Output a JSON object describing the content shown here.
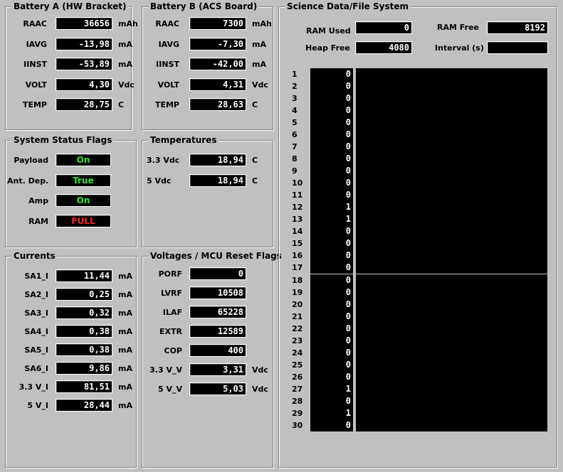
{
  "battery_a": {
    "title": "Battery A (HW Bracket)",
    "rows": [
      {
        "label": "RAAC",
        "value": "36656",
        "unit": "mAh"
      },
      {
        "label": "IAVG",
        "value": "-13,98",
        "unit": "mA"
      },
      {
        "label": "IINST",
        "value": "-53,89",
        "unit": "mA"
      },
      {
        "label": "VOLT",
        "value": "4,30",
        "unit": "Vdc"
      },
      {
        "label": "TEMP",
        "value": "28,75",
        "unit": "C"
      }
    ]
  },
  "battery_b": {
    "title": "Battery B (ACS Board)",
    "rows": [
      {
        "label": "RAAC",
        "value": "7300",
        "unit": "mAh"
      },
      {
        "label": "IAVG",
        "value": "-7,30",
        "unit": "mA"
      },
      {
        "label": "IINST",
        "value": "-42,00",
        "unit": "mA"
      },
      {
        "label": "VOLT",
        "value": "4,31",
        "unit": "Vdc"
      },
      {
        "label": "TEMP",
        "value": "28,63",
        "unit": "C"
      }
    ]
  },
  "status_flags": {
    "title": "System Status Flags",
    "rows": [
      {
        "label": "Payload",
        "value": "On",
        "color": "#2ee82e"
      },
      {
        "label": "Ant. Dep.",
        "value": "True",
        "color": "#2ee82e"
      },
      {
        "label": "Amp",
        "value": "On",
        "color": "#2ee82e"
      },
      {
        "label": "RAM",
        "value": "FULL",
        "color": "#ff2020"
      }
    ]
  },
  "temperatures": {
    "title": "Temperatures",
    "rows": [
      {
        "label": "3.3 Vdc",
        "value": "18,94",
        "unit": "C"
      },
      {
        "label": "5 Vdc",
        "value": "18,94",
        "unit": "C"
      }
    ]
  },
  "currents": {
    "title": "Currents",
    "rows": [
      {
        "label": "SA1_I",
        "value": "11,44",
        "unit": "mA"
      },
      {
        "label": "SA2_I",
        "value": "0,25",
        "unit": "mA"
      },
      {
        "label": "SA3_I",
        "value": "0,32",
        "unit": "mA"
      },
      {
        "label": "SA4_I",
        "value": "0,38",
        "unit": "mA"
      },
      {
        "label": "SA5_I",
        "value": "0,38",
        "unit": "mA"
      },
      {
        "label": "SA6_I",
        "value": "9,86",
        "unit": "mA"
      },
      {
        "label": "3.3 V_I",
        "value": "81,51",
        "unit": "mA"
      },
      {
        "label": "5 V_I",
        "value": "28,44",
        "unit": "mA"
      }
    ]
  },
  "voltages": {
    "title": "Voltages / MCU Reset Flags",
    "rows": [
      {
        "label": "PORF",
        "value": "0",
        "unit": ""
      },
      {
        "label": "LVRF",
        "value": "10508",
        "unit": ""
      },
      {
        "label": "ILAF",
        "value": "65228",
        "unit": ""
      },
      {
        "label": "EXTR",
        "value": "12589",
        "unit": ""
      },
      {
        "label": "COP",
        "value": "400",
        "unit": ""
      },
      {
        "label": "3.3 V_V",
        "value": "3,31",
        "unit": "Vdc"
      },
      {
        "label": "5 V_V",
        "value": "5,03",
        "unit": "Vdc"
      }
    ]
  },
  "science": {
    "title": "Science Data/File System",
    "ram_used_label": "RAM Used",
    "ram_used_value": "0",
    "ram_free_label": "RAM Free",
    "ram_free_value": "8192",
    "heap_free_label": "Heap Free",
    "heap_free_value": "4080",
    "interval_label": "Interval (s)",
    "interval_value": "",
    "entries": [
      {
        "index": "1",
        "value": "0"
      },
      {
        "index": "2",
        "value": "0"
      },
      {
        "index": "3",
        "value": "0"
      },
      {
        "index": "4",
        "value": "0"
      },
      {
        "index": "5",
        "value": "0"
      },
      {
        "index": "6",
        "value": "0"
      },
      {
        "index": "7",
        "value": "0"
      },
      {
        "index": "8",
        "value": "0"
      },
      {
        "index": "9",
        "value": "0"
      },
      {
        "index": "10",
        "value": "0"
      },
      {
        "index": "11",
        "value": "0"
      },
      {
        "index": "12",
        "value": "1"
      },
      {
        "index": "13",
        "value": "1"
      },
      {
        "index": "14",
        "value": "0"
      },
      {
        "index": "15",
        "value": "0"
      },
      {
        "index": "16",
        "value": "0"
      },
      {
        "index": "17",
        "value": "0"
      },
      {
        "index": "18",
        "value": "0"
      },
      {
        "index": "19",
        "value": "0"
      },
      {
        "index": "20",
        "value": "0"
      },
      {
        "index": "21",
        "value": "0"
      },
      {
        "index": "22",
        "value": "0"
      },
      {
        "index": "23",
        "value": "0"
      },
      {
        "index": "24",
        "value": "0"
      },
      {
        "index": "25",
        "value": "0"
      },
      {
        "index": "26",
        "value": "0"
      },
      {
        "index": "27",
        "value": "1"
      },
      {
        "index": "28",
        "value": "0"
      },
      {
        "index": "29",
        "value": "1"
      },
      {
        "index": "30",
        "value": "0"
      }
    ]
  }
}
